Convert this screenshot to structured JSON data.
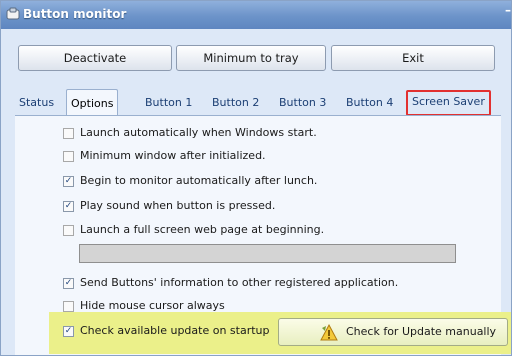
{
  "window": {
    "title": "Button monitor",
    "min_glyph": "–"
  },
  "toolbar": {
    "deactivate": "Deactivate",
    "minimize_to_tray": "Minimum to tray",
    "exit": "Exit"
  },
  "tabs": [
    "Status",
    "Options",
    "Button 1",
    "Button 2",
    "Button 3",
    "Button 4",
    "Screen Saver"
  ],
  "active_tab": "Options",
  "options": [
    {
      "label": "Launch automatically when Windows start.",
      "checked": false
    },
    {
      "label": "Minimum window after initialized.",
      "checked": false
    },
    {
      "label": "Begin to monitor automatically after lunch.",
      "checked": true
    },
    {
      "label": "Play sound when button is pressed.",
      "checked": true
    },
    {
      "label": "Launch a full screen web page at beginning.",
      "checked": false
    },
    {
      "label": "Send Buttons' information to other registered application.",
      "checked": true
    },
    {
      "label": "Hide mouse cursor always",
      "checked": false
    },
    {
      "label": "Check available update on startup",
      "checked": true
    }
  ],
  "url_field_value": "",
  "update_button": "Check for Update manually",
  "check_glyph": "✓",
  "colors": {
    "highlight": "#ebf08a",
    "callout_border": "#e23030",
    "titlebar": "#6c93c9"
  }
}
